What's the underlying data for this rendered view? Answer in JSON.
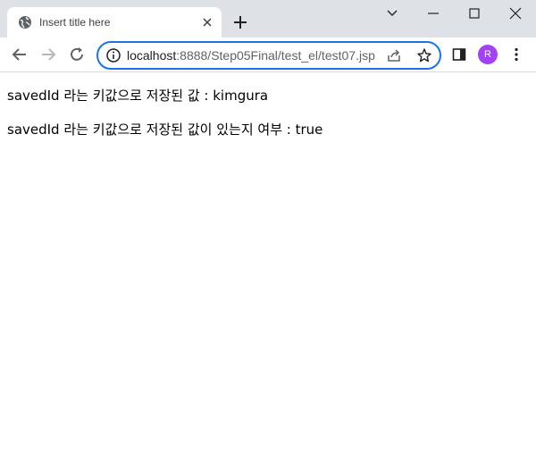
{
  "tab": {
    "title": "Insert title here",
    "favicon": "globe-icon",
    "close_icon": "close-icon",
    "new_tab_icon": "plus-icon"
  },
  "window_controls": {
    "icons": [
      "chevron-down-icon",
      "minimize-icon",
      "maximize-icon",
      "close-icon"
    ]
  },
  "toolbar": {
    "back_icon": "arrow-left-icon",
    "forward_icon": "arrow-right-icon",
    "reload_icon": "reload-icon",
    "url_host": "localhost",
    "url_rest": ":8888/Step05Final/test_el/test07.jsp",
    "info_icon": "info-icon",
    "share_icon": "share-icon",
    "star_icon": "star-icon",
    "sidepanel_icon": "side-panel-icon",
    "profile_initial": "R",
    "menu_icon": "kebab-menu-icon"
  },
  "colors": {
    "accent": "#1a73e8",
    "tabstrip": "#dee1e6",
    "avatar": "#a142f4"
  },
  "page": {
    "line1": "savedId 라는 키값으로 저장된 값 : kimgura",
    "line2": "savedId 라는 키값으로 저장된 값이 있는지 여부 : true"
  }
}
